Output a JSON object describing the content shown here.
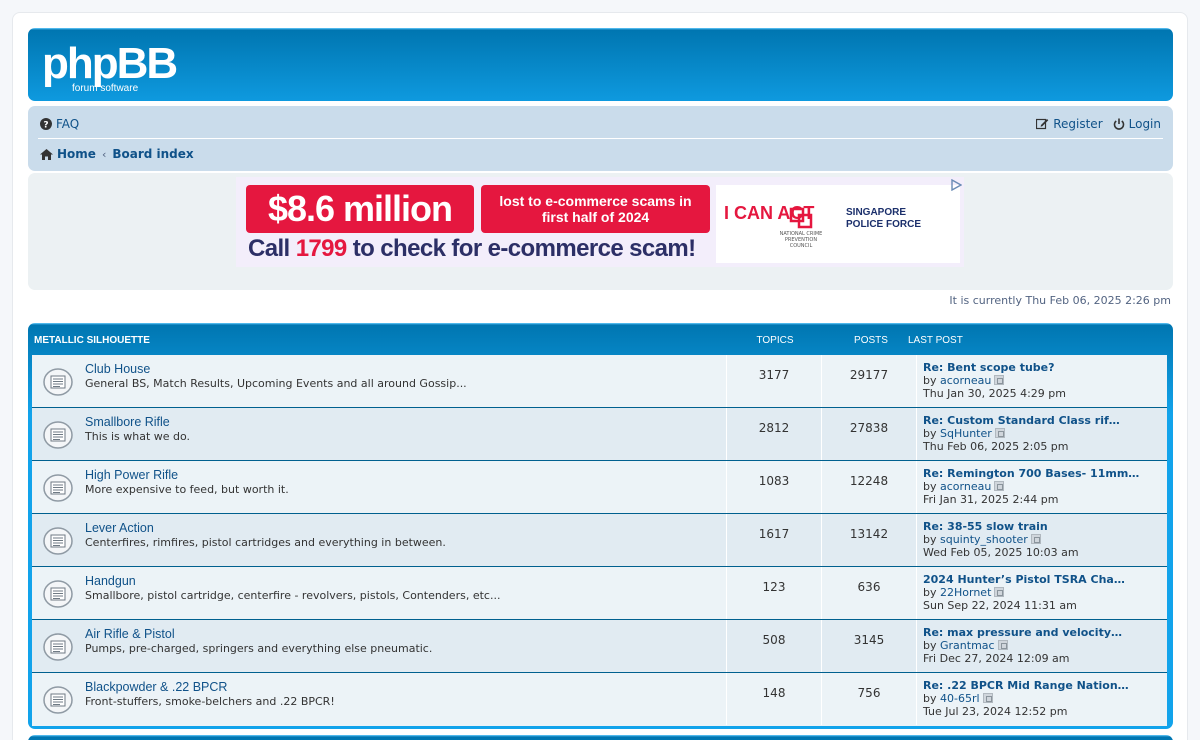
{
  "header": {
    "logo_text": "phpBB",
    "logo_sub": "forum software"
  },
  "nav": {
    "faq": "FAQ",
    "register": "Register",
    "login": "Login",
    "home": "Home",
    "board_index": "Board index"
  },
  "ad": {
    "amount": "$8.6 million",
    "lost_text": "lost to e-commerce scams in first half of 2024",
    "call_prefix": "Call ",
    "call_number": "1799",
    "call_suffix": " to check for e-commerce scam!",
    "logo1": "I CAN ACT",
    "logo2": "NATIONAL CRIME PREVENTION COUNCIL",
    "logo3_line1": "SINGAPORE",
    "logo3_line2": "POLICE FORCE"
  },
  "current_time": "It is currently Thu Feb 06, 2025 2:26 pm",
  "category": {
    "name": "METALLIC SILHOUETTE",
    "col_topics": "TOPICS",
    "col_posts": "POSTS",
    "col_last": "LAST POST"
  },
  "forums": [
    {
      "title": "Club House",
      "desc": "General BS, Match Results, Upcoming Events and all around Gossip...",
      "topics": "3177",
      "posts": "29177",
      "last_title": "Re: Bent scope tube?",
      "by": "by ",
      "last_author": "acorneau",
      "last_date": "Thu Jan 30, 2025 4:29 pm"
    },
    {
      "title": "Smallbore Rifle",
      "desc": "This is what we do.",
      "topics": "2812",
      "posts": "27838",
      "last_title": "Re: Custom Standard Class rif…",
      "by": "by ",
      "last_author": "SqHunter",
      "last_date": "Thu Feb 06, 2025 2:05 pm"
    },
    {
      "title": "High Power Rifle",
      "desc": "More expensive to feed, but worth it.",
      "topics": "1083",
      "posts": "12248",
      "last_title": "Re: Remington 700 Bases- 11mm…",
      "by": "by ",
      "last_author": "acorneau",
      "last_date": "Fri Jan 31, 2025 2:44 pm"
    },
    {
      "title": "Lever Action",
      "desc": "Centerfires, rimfires, pistol cartridges and everything in between.",
      "topics": "1617",
      "posts": "13142",
      "last_title": "Re: 38-55 slow train",
      "by": "by ",
      "last_author": "squinty_shooter",
      "last_date": "Wed Feb 05, 2025 10:03 am"
    },
    {
      "title": "Handgun",
      "desc": "Smallbore, pistol cartridge, centerfire - revolvers, pistols, Contenders, etc...",
      "topics": "123",
      "posts": "636",
      "last_title": "2024 Hunter’s Pistol TSRA Cha…",
      "by": "by ",
      "last_author": "22Hornet",
      "last_date": "Sun Sep 22, 2024 11:31 am"
    },
    {
      "title": "Air Rifle & Pistol",
      "desc": "Pumps, pre-charged, springers and everything else pneumatic.",
      "topics": "508",
      "posts": "3145",
      "last_title": "Re: max pressure and velocity…",
      "by": "by ",
      "last_author": "Grantmac",
      "last_date": "Fri Dec 27, 2024 12:09 am"
    },
    {
      "title": "Blackpowder & .22 BPCR",
      "desc": "Front-stuffers, smoke-belchers and .22 BPCR!",
      "topics": "148",
      "posts": "756",
      "last_title": "Re: .22 BPCR Mid Range Nation…",
      "by": "by ",
      "last_author": "40-65rl",
      "last_date": "Tue Jul 23, 2024 12:52 pm"
    }
  ]
}
